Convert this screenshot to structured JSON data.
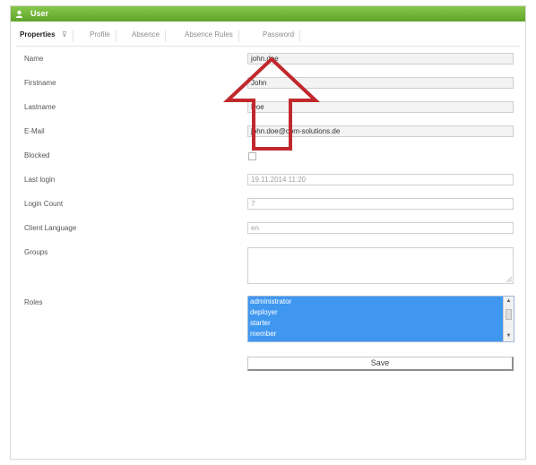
{
  "window": {
    "title": "User",
    "title_icon": "user-icon",
    "accent_color": "#6cb33a"
  },
  "tabs": [
    {
      "label": "Properties",
      "active": true
    },
    {
      "label": "Profile",
      "active": false
    },
    {
      "label": "Absence",
      "active": false
    },
    {
      "label": "Absence Rules",
      "active": false
    },
    {
      "label": "Password",
      "active": false
    }
  ],
  "fields": {
    "name": {
      "label": "Name",
      "value": "john.doe"
    },
    "firstname": {
      "label": "Firstname",
      "value": "John"
    },
    "lastname": {
      "label": "Lastname",
      "value": "Doe"
    },
    "email": {
      "label": "E-Mail",
      "value": "john.doe@com-solutions.de"
    },
    "blocked": {
      "label": "Blocked",
      "checked": false
    },
    "last_login": {
      "label": "Last login",
      "value": "19.11.2014 11:20"
    },
    "login_count": {
      "label": "Login Count",
      "value": "7"
    },
    "client_language": {
      "label": "Client Language",
      "value": "en"
    },
    "groups": {
      "label": "Groups",
      "value": ""
    },
    "roles": {
      "label": "Roles",
      "options": [
        "administrator",
        "deployer",
        "starter",
        "member"
      ],
      "selection_color": "#3f97f0"
    }
  },
  "actions": {
    "save_label": "Save"
  },
  "overlay": {
    "arrow_color": "#c0282d",
    "arrow_direction": "up"
  }
}
